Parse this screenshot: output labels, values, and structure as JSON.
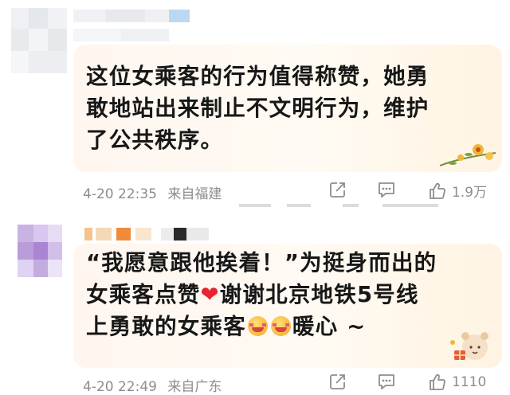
{
  "comments": [
    {
      "lines": [
        "这位女乘客的行为值得称赞，她勇",
        "敢地站出来制止不文明行为，维护",
        "了公共秩序。"
      ],
      "date_time": "4-20 22:35",
      "location": "来自福建",
      "like_count": "1.9万"
    },
    {
      "line1": "“我愿意跟他挨着！”为挺身而出的",
      "line2_a": "女乘客点赞",
      "heart": "❤",
      "line2_b": "谢谢北京地铁5号线",
      "line3_a": "上勇敢的女乘客",
      "line3_b": "暖心 ~",
      "date_time": "4-20 22:49",
      "location": "来自广东",
      "like_count": "1110"
    }
  ],
  "icons": [
    "share-icon",
    "comment-icon",
    "like-icon"
  ],
  "colors": {
    "meta_gray": "#8d8d8d",
    "heart_red": "#e8232e",
    "bubble_tint": "#fff6f0"
  }
}
